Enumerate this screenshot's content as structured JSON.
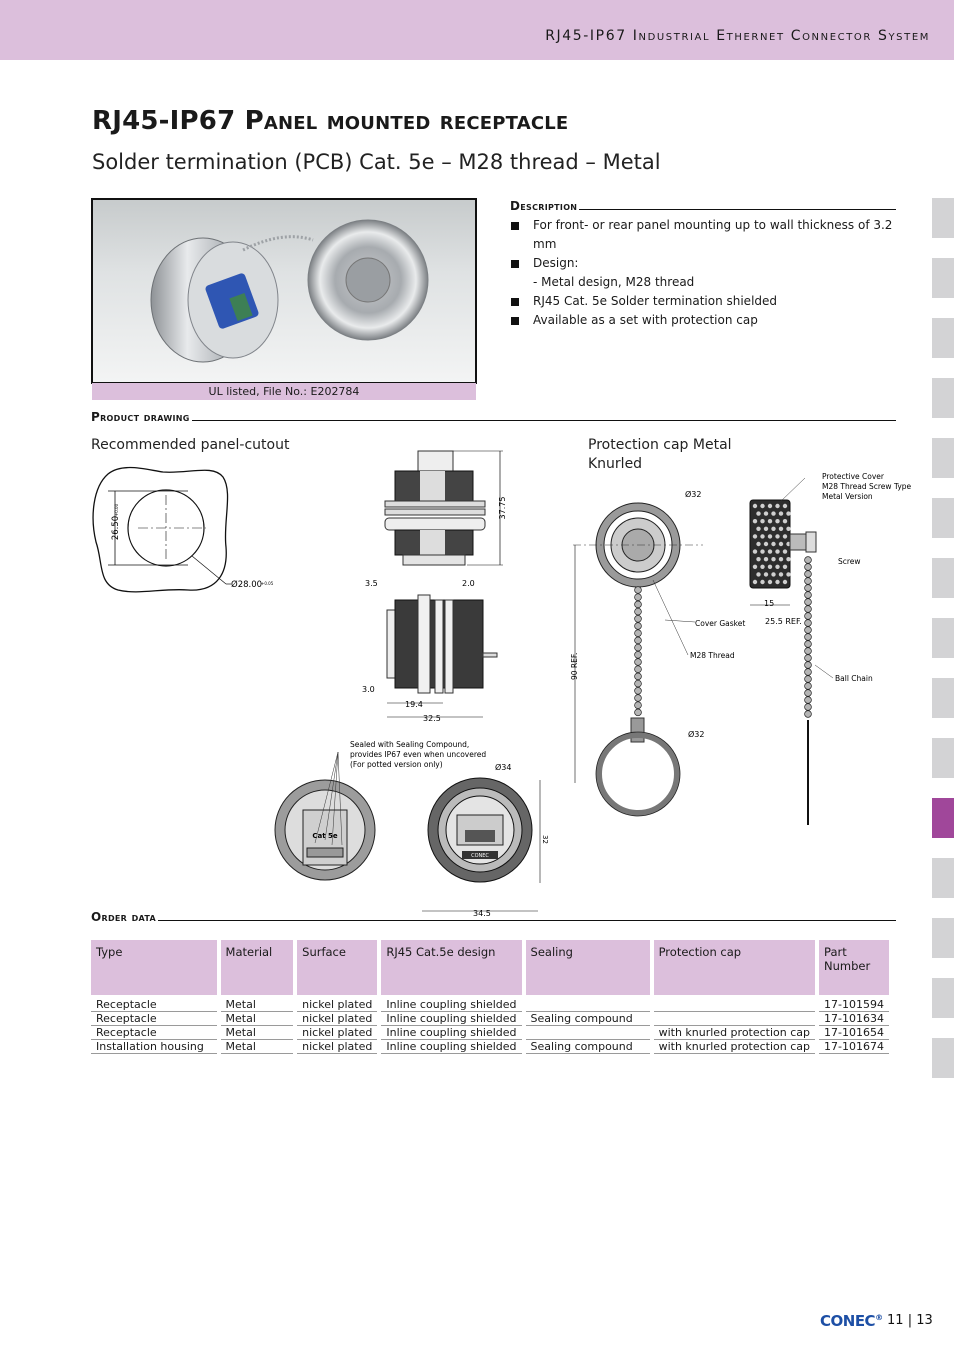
{
  "header": {
    "series_title": "RJ45-IP67 Industrial Ethernet Connector System"
  },
  "page": {
    "title": "RJ45-IP67 Panel mounted receptacle",
    "subtitle": "Solder termination (PCB) Cat. 5e – M28 thread – Metal"
  },
  "photo": {
    "caption": "UL listed, File No.: E202784"
  },
  "description": {
    "heading": "Description",
    "items": [
      {
        "text": "For front- or rear panel mounting up to wall thickness of 3.2 mm",
        "sub": ""
      },
      {
        "text": "Design:",
        "sub": "- Metal design, M28 thread"
      },
      {
        "text": "RJ45 Cat. 5e Solder termination shielded",
        "sub": ""
      },
      {
        "text": "Available as a set with protection cap",
        "sub": ""
      }
    ]
  },
  "product_drawing": {
    "heading": "Product drawing",
    "cutout": {
      "label": "Recommended panel-cutout",
      "dim_height": "26.50",
      "dim_height_tol": "+0.00",
      "dim_diameter": "Ø28.00",
      "dim_diameter_tol": "+0.05"
    },
    "side_view": {
      "dim_height": "37.75",
      "dim_a": "3.5",
      "dim_b": "2.0",
      "dim_c": "3.0",
      "dim_d": "19.4",
      "dim_e": "32.5"
    },
    "front_views": {
      "note_line1": "Sealed with Sealing Compound,",
      "note_line2": "provides IP67 even when uncovered",
      "note_line3": "(For potted version only)",
      "cat_label": "Cat 5e",
      "dim_diameter": "Ø34",
      "dim_height": "32",
      "dim_width": "34.5",
      "brand": "CONEC"
    },
    "cap": {
      "label_line1": "Protection cap Metal",
      "label_line2": "Knurled",
      "dim_diameter_top": "Ø32",
      "dim_diameter_ring": "Ø32",
      "dim_length": "90 REF.",
      "dim_width": "15",
      "dim_ref": "25.5 REF.",
      "callout_cover_1": "Protective Cover",
      "callout_cover_2": "M28 Thread Screw Type",
      "callout_cover_3": "Metal Version",
      "callout_screw": "Screw",
      "callout_gasket": "Cover Gasket",
      "callout_thread": "M28 Thread",
      "callout_chain": "Ball Chain"
    }
  },
  "order_data": {
    "heading": "Order data",
    "columns": [
      "Type",
      "Material",
      "Surface",
      "RJ45 Cat.5e design",
      "Sealing",
      "Protection cap",
      "Part Number"
    ],
    "rows": [
      [
        "Receptacle",
        "Metal",
        "nickel plated",
        "Inline coupling shielded",
        "",
        "",
        "17-101594"
      ],
      [
        "Receptacle",
        "Metal",
        "nickel plated",
        "Inline coupling shielded",
        "Sealing compound",
        "",
        "17-101634"
      ],
      [
        "Receptacle",
        "Metal",
        "nickel plated",
        "Inline coupling shielded",
        "",
        "with knurled protection cap",
        "17-101654"
      ],
      [
        "Installation housing",
        "Metal",
        "nickel plated",
        "Inline coupling shielded",
        "Sealing compound",
        "with knurled protection cap",
        "17-101674"
      ]
    ]
  },
  "side_tabs": {
    "count": 15,
    "active_index": 10,
    "color_inactive": "#d3d3d5",
    "color_active": "#a0479a"
  },
  "footer": {
    "brand": "CONEC",
    "registered": "®",
    "page_current": "11",
    "separator": "|",
    "page_total": "13"
  },
  "colors": {
    "header_band": "#dcbfdc",
    "brand_blue": "#1d4fa5"
  }
}
